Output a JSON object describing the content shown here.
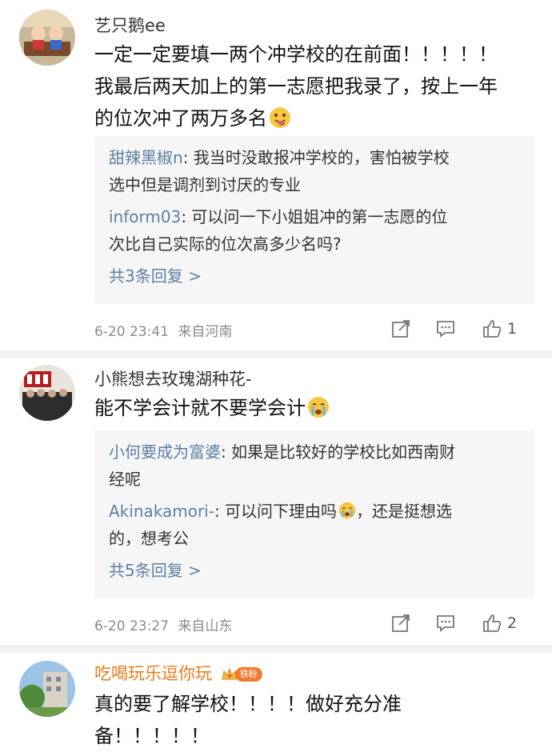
{
  "comments": [
    {
      "username": "艺只鹅ee",
      "text_line1": "一定一定要填一两个冲学校的在前面！！！！！",
      "text_line2": "我最后两天加上的第一志愿把我录了，按上一年",
      "text_line3": "的位次冲了两万多名",
      "emoji": "tongue-out-emoji",
      "replies": [
        {
          "name": "甜辣黑椒n",
          "sep": ": ",
          "text1": "我当时没敢报冲学校的，害怕被学校",
          "text2": "选中但是调剂到讨厌的专业"
        },
        {
          "name": "inform03",
          "sep": ": ",
          "text1": "可以问一下小姐姐冲的第一志愿的位",
          "text2": "次比自己实际的位次高多少名吗?"
        }
      ],
      "more_replies": "共3条回复 >",
      "timestamp": "6-20 23:41",
      "location": "来自河南",
      "like_count": "1"
    },
    {
      "username": "小熊想去玫瑰湖种花-",
      "text_line1": "能不学会计就不要学会计",
      "emoji": "crying-emoji",
      "replies": [
        {
          "name": "小何要成为富婆",
          "sep": ": ",
          "text1": "如果是比较好的学校比如西南财",
          "text2": "经呢"
        },
        {
          "name": "Akinakamori-",
          "sep": ": ",
          "text1": "可以问下理由吗",
          "text1b": "，还是挺想选",
          "text2": "的，想考公"
        }
      ],
      "more_replies": "共5条回复 >",
      "timestamp": "6-20 23:27",
      "location": "来自山东",
      "like_count": "2"
    },
    {
      "username": "吃喝玩乐逗你玩",
      "badge": "铁粉",
      "text_line1": "真的要了解学校！！！！做好充分准",
      "text_line2": "备！！！！！"
    }
  ],
  "colors": {
    "link": "#5d7fa3",
    "accent": "#ea7a1b",
    "reply_bg": "#f6f6f6"
  },
  "icons": [
    "share-icon",
    "comment-icon",
    "like-icon"
  ]
}
